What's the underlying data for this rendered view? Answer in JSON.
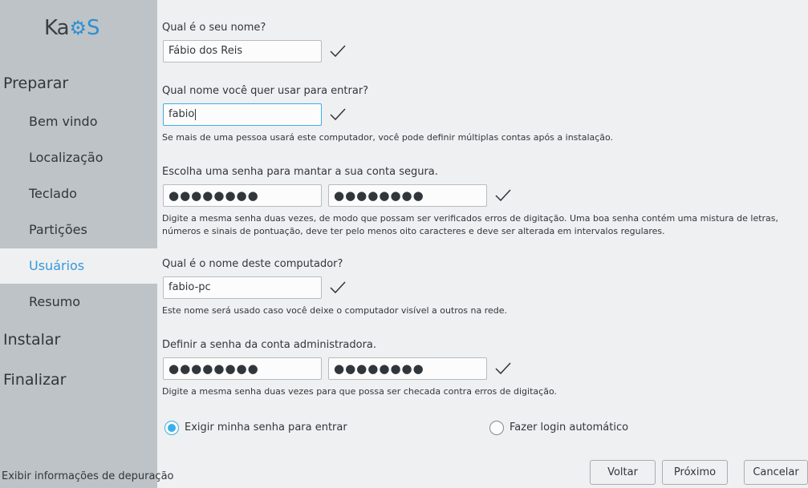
{
  "sidebar": {
    "logo": {
      "part1": "Ka",
      "gear": "⚙",
      "part2": "S"
    },
    "sections": {
      "prepare": "Preparar",
      "install": "Instalar",
      "finish": "Finalizar"
    },
    "steps": [
      "Bem vindo",
      "Localização",
      "Teclado",
      "Partições",
      "Usuários",
      "Resumo"
    ],
    "active_step": "Usuários",
    "debug_label": "Exibir informações de depuração"
  },
  "form": {
    "name_label": "Qual é o seu nome?",
    "name_value": "Fábio dos Reis",
    "login_label": "Qual nome você quer usar para entrar?",
    "login_value": "fabio",
    "login_hint": "Se mais de uma pessoa usará este computador, você pode definir múltiplas contas após a instalação.",
    "password_label": "Escolha uma senha para mantar a sua conta segura.",
    "password_value": "●●●●●●●●",
    "password_confirm_value": "●●●●●●●●",
    "password_hint": "Digite a mesma senha duas vezes, de modo que possam ser verificados erros de digitação. Uma boa senha contém uma mistura de letras, números e sinais de pontuação, deve ter pelo menos oito caracteres e deve ser alterada em intervalos regulares.",
    "hostname_label": "Qual é o nome deste computador?",
    "hostname_value": "fabio-pc",
    "hostname_hint": "Este nome será usado caso você deixe o computador visível a outros na rede.",
    "admin_label": "Definir a senha da conta administradora.",
    "admin_value": "●●●●●●●●",
    "admin_confirm_value": "●●●●●●●●",
    "admin_hint": "Digite a mesma senha duas vezes para que possa ser checada contra erros de digitação.",
    "radio_require_password": "Exigir minha senha para entrar",
    "radio_auto_login": "Fazer login automático",
    "selected_radio": "Exigir minha senha para entrar"
  },
  "buttons": {
    "back": "Voltar",
    "next": "Próximo",
    "cancel": "Cancelar"
  },
  "colors": {
    "accent": "#3daee9",
    "sidebar_bg": "#bdc3c7",
    "page_bg": "#eff0f1"
  }
}
